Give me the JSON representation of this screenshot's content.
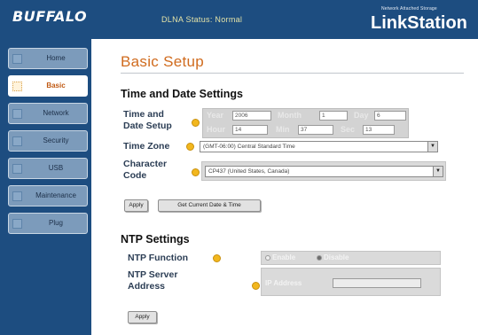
{
  "header": {
    "logo": "BUFFALO",
    "dlna_status": "DLNA Status: Normal",
    "brand_small": "Network Attached Storage",
    "brand_big": "LinkStation"
  },
  "sidebar": {
    "items": [
      {
        "label": "Home"
      },
      {
        "label": "Basic"
      },
      {
        "label": "Network"
      },
      {
        "label": "Security"
      },
      {
        "label": "USB"
      },
      {
        "label": "Maintenance"
      },
      {
        "label": "Plug"
      }
    ]
  },
  "page": {
    "title": "Basic Setup",
    "time_date": {
      "section_title": "Time and Date Settings",
      "time_date_setup_label": "Time and Date Setup",
      "year_label": "Year",
      "year_value": "2006",
      "month_label": "Month",
      "month_value": "1",
      "day_label": "Day",
      "day_value": "6",
      "hour_label": "Hour",
      "hour_value": "14",
      "min_label": "Min",
      "min_value": "37",
      "sec_label": "Sec",
      "sec_value": "13",
      "time_zone_label": "Time Zone",
      "time_zone_value": "(GMT-06:00) Central Standard Time",
      "charset_label": "Character Code",
      "charset_value": "CP437 (United States, Canada)",
      "apply_label": "Apply",
      "get_current_label": "Get Current Date & Time"
    },
    "ntp": {
      "section_title": "NTP Settings",
      "function_label": "NTP Function",
      "enable_label": "Enable",
      "disable_label": "Disable",
      "server_label": "NTP Server Address",
      "ip_label": "IP Address",
      "ip_value": "",
      "apply_label": "Apply"
    }
  },
  "colors": {
    "header_bg": "#1d4d80",
    "title_orange": "#d06b1e",
    "info_icon": "#f2b71e"
  }
}
